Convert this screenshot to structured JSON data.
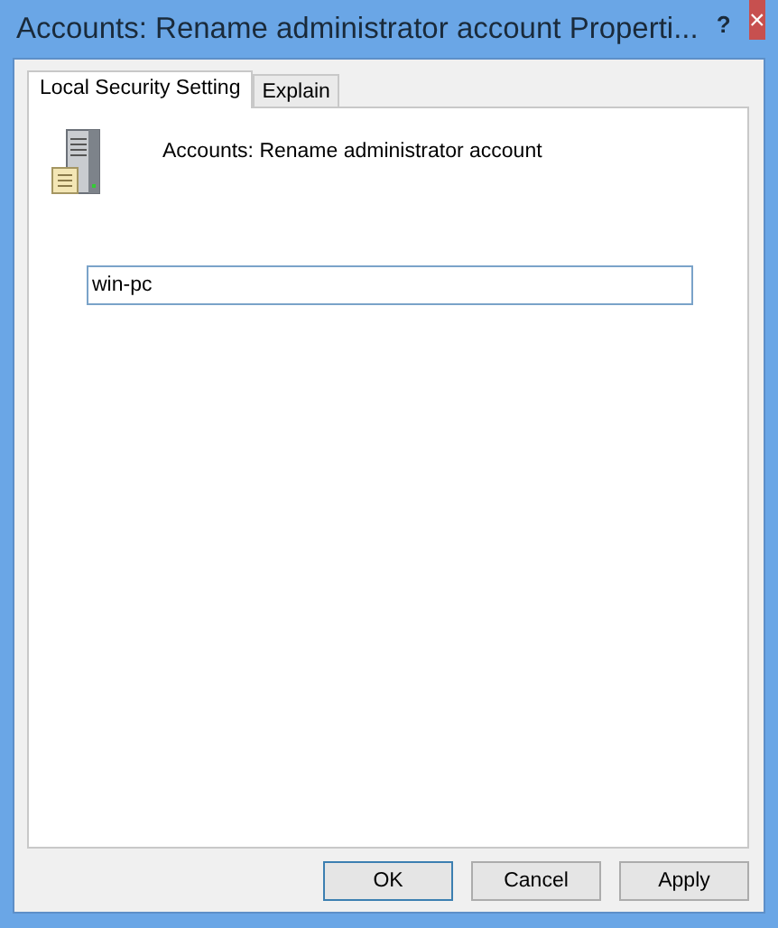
{
  "window": {
    "title": "Accounts: Rename administrator account Properti...",
    "help": "?",
    "close": "×"
  },
  "tabs": [
    {
      "label": "Local Security Setting",
      "selected": true
    },
    {
      "label": "Explain",
      "selected": false
    }
  ],
  "policy": {
    "name": "Accounts: Rename administrator account"
  },
  "field": {
    "value": "win-pc"
  },
  "buttons": [
    {
      "label": "OK",
      "selected": true
    },
    {
      "label": "Cancel",
      "selected": false
    },
    {
      "label": "Apply",
      "selected": false
    }
  ]
}
